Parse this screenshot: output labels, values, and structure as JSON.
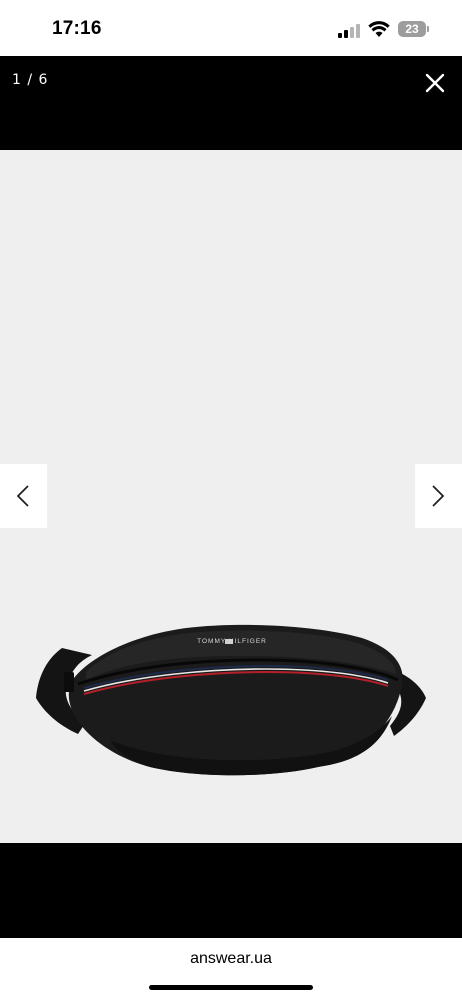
{
  "status_bar": {
    "time": "17:16",
    "battery": "23"
  },
  "viewer": {
    "counter": "1 / 6",
    "close_icon": "close-icon",
    "prev_icon": "chevron-left-icon",
    "next_icon": "chevron-right-icon"
  },
  "product": {
    "brand_text": "TOMMY HILFIGER"
  },
  "browser": {
    "url": "answear.ua"
  },
  "colors": {
    "header_bg": "#000000",
    "image_bg": "#efefef",
    "bag": "#1a1a1a",
    "stripe_red": "#b4202a",
    "stripe_navy": "#1e2a4a"
  }
}
